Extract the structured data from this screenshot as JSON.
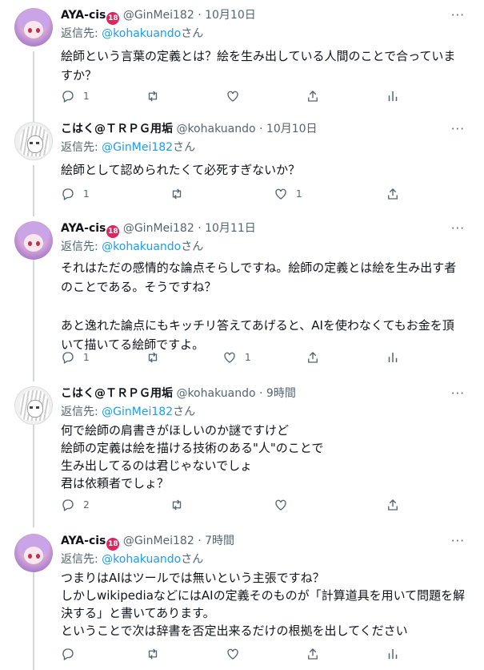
{
  "tweets": [
    {
      "author": "AYA-cis",
      "badge": "18",
      "handle": "@GinMei182",
      "dot": "·",
      "date": "10月10日",
      "reply_prefix": "返信先: ",
      "reply_to": "@kohakuando",
      "reply_suffix": "さん",
      "lines": [
        "絵師という言葉の定義とは？絵を生み出している人間のことで合っていま",
        "すか？"
      ],
      "replies": "1",
      "retweets": "",
      "likes": ""
    },
    {
      "author": "こはく@ＴＲＰＧ用垢",
      "badge": "",
      "handle": "@kohakuando",
      "dot": "·",
      "date": "10月10日",
      "reply_prefix": "返信先: ",
      "reply_to": "@GinMei182",
      "reply_suffix": "さん",
      "lines": [
        "絵師として認められたくて必死すぎないか？"
      ],
      "replies": "1",
      "retweets": "",
      "likes": "1"
    },
    {
      "author": "AYA-cis",
      "badge": "18",
      "handle": "@GinMei182",
      "dot": "·",
      "date": "10月11日",
      "reply_prefix": "返信先: ",
      "reply_to": "@kohakuando",
      "reply_suffix": "さん",
      "lines": [
        "それはただの感情的な論点そらしですね。絵師の定義とは絵を生み出す者",
        "のことである。そうですね？",
        "",
        "あと逸れた論点にもキッチリ答えてあげると、AIを使わなくてもお金を頂",
        "いて描いてる絵師ですよ。"
      ],
      "replies": "1",
      "retweets": "",
      "likes": "1"
    },
    {
      "author": "こはく@ＴＲＰＧ用垢",
      "badge": "",
      "handle": "@kohakuando",
      "dot": "·",
      "date": "9時間",
      "reply_prefix": "返信先: ",
      "reply_to": "@GinMei182",
      "reply_suffix": "さん",
      "lines": [
        "何で絵師の肩書きがほしいのか謎ですけど",
        "絵師の定義は絵を描ける技術のある\"人\"のことで",
        "生み出してるのは君じゃないでしょ",
        "君は依頼者でしょ？"
      ],
      "replies": "2",
      "retweets": "",
      "likes": ""
    },
    {
      "author": "AYA-cis",
      "badge": "18",
      "handle": "@GinMei182",
      "dot": "·",
      "date": "7時間",
      "reply_prefix": "返信先: ",
      "reply_to": "@kohakuando",
      "reply_suffix": "さん",
      "lines": [
        "つまりはAIはツールでは無いという主張ですね？",
        "しかしwikipediaなどにはAIの定義そのものが「計算道具を用いて問題を解",
        "決する」と書いてあります。",
        "ということで次は辞書を否定出来るだけの根拠を出してください"
      ],
      "replies": "",
      "retweets": "",
      "likes": ""
    }
  ],
  "more_label": "···",
  "colors": {
    "accent": "#1d9bf0",
    "muted": "#536471",
    "text": "#0f1419",
    "badge": "#e0245e"
  },
  "icons": [
    "reply-icon",
    "retweet-icon",
    "like-icon",
    "share-icon",
    "analytics-icon",
    "more-icon"
  ]
}
